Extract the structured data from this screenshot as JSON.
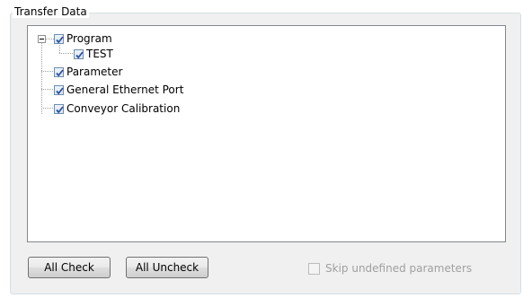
{
  "group": {
    "title": "Transfer Data"
  },
  "tree": {
    "items": [
      {
        "label": "Program",
        "checked": true,
        "expanded": true
      },
      {
        "label": "TEST",
        "checked": true
      },
      {
        "label": "Parameter",
        "checked": true
      },
      {
        "label": "General Ethernet Port",
        "checked": true
      },
      {
        "label": "Conveyor Calibration",
        "checked": true
      }
    ]
  },
  "buttons": {
    "all_check": "All Check",
    "all_uncheck": "All Uncheck"
  },
  "skip_undefined": {
    "label": "Skip undefined parameters",
    "checked": false,
    "enabled": false
  },
  "colors": {
    "checkmark": "#2e50a8",
    "checkbox_border": "#6d8ead",
    "group_background": "#f0f0f0"
  }
}
